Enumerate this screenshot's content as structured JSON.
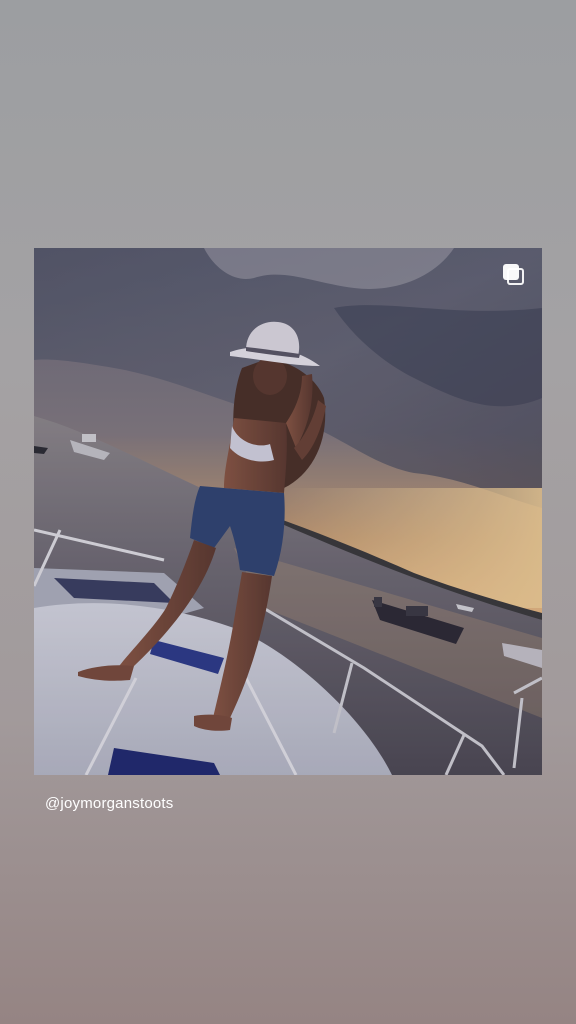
{
  "story": {
    "shared_post": {
      "username": "@joymorganstoots",
      "photo_description_icon": "carousel-multiple-icon"
    }
  }
}
